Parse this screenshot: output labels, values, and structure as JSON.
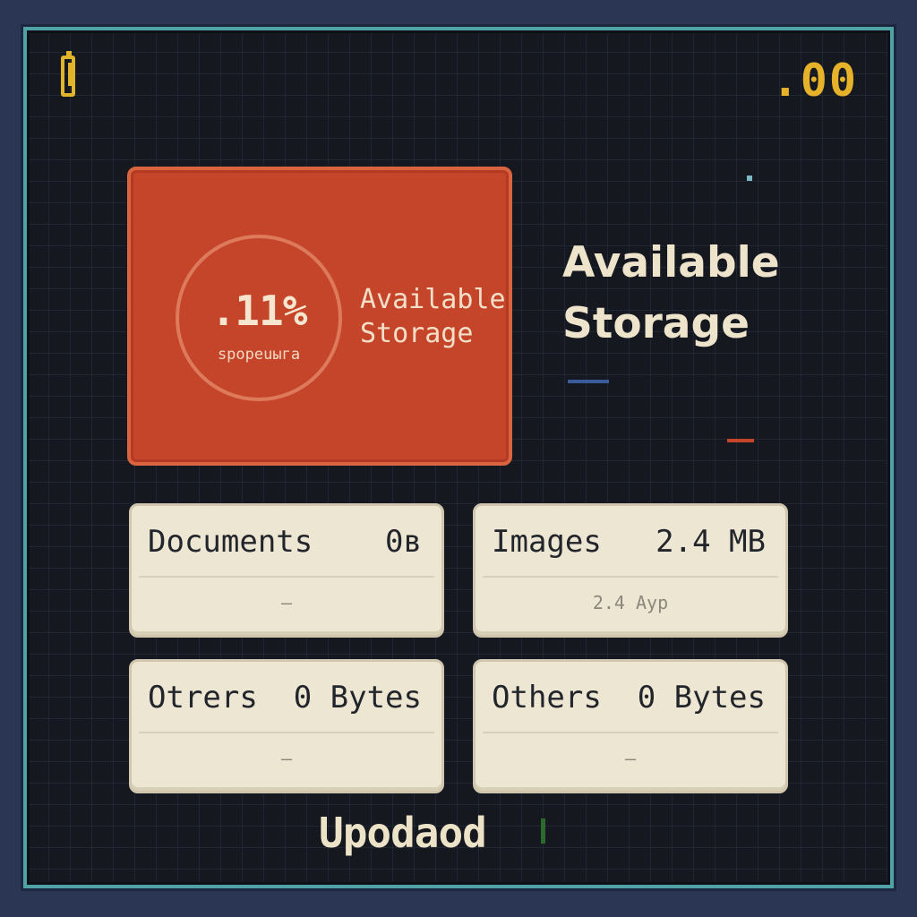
{
  "status_bar": {
    "battery_icon": "battery-icon",
    "time": ".00"
  },
  "storage_card": {
    "percent": ".11%",
    "caption": "spoреuыга",
    "label": "Available Storage",
    "color": "#c5452a"
  },
  "headline": "Available Storage",
  "tiles": [
    {
      "name": "Documents",
      "size": "0в",
      "detail": "–"
    },
    {
      "name": "Images",
      "size": "2.4 MB",
      "detail": "2.4 Ayp"
    },
    {
      "name": "Otrers",
      "size": "0 Bytes",
      "detail": "–"
    },
    {
      "name": "Others",
      "size": "0 Bytes",
      "detail": "–"
    }
  ],
  "upload_button": {
    "label": "Upodaod"
  },
  "colors": {
    "accent": "#c5452a",
    "border": "#4fa3a5",
    "time": "#e6b22a",
    "tile": "#ede6d2",
    "background": "#15181f"
  }
}
